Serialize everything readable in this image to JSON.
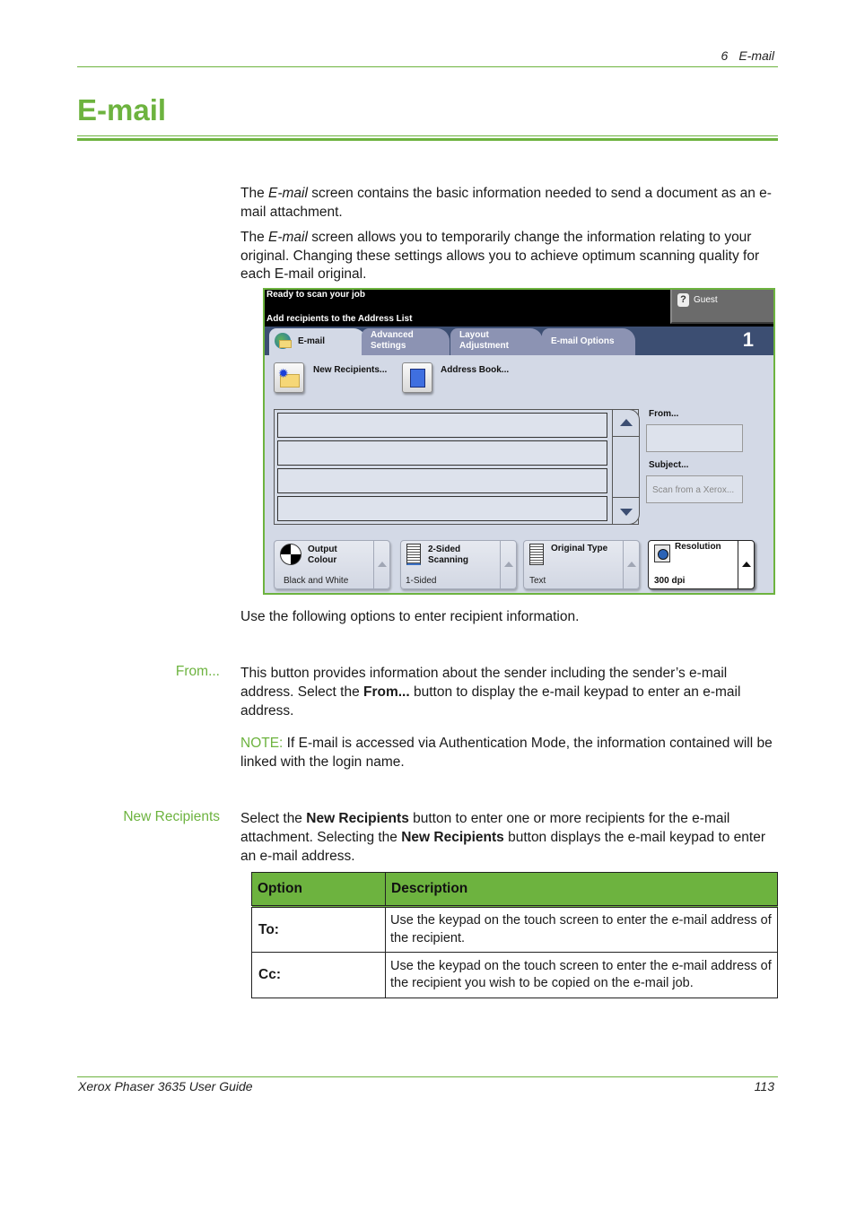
{
  "header": {
    "chapter_number": "6",
    "chapter_title": "E-mail"
  },
  "page_title": "E-mail",
  "intro": {
    "p1_pre": "The ",
    "p1_em": "E-mail",
    "p1_post": " screen contains the basic information needed to send a document as an e-mail attachment.",
    "p2_pre": "The ",
    "p2_em": "E-mail",
    "p2_post": " screen allows you to temporarily change the information relating to your original. Changing these settings allows you to achieve optimum scanning quality for each E-mail original."
  },
  "device_screen": {
    "status_line_1": "Ready to scan your job",
    "status_line_2": "Add recipients to the Address List",
    "user_button": "Guest",
    "page_count": "1",
    "tabs": [
      {
        "label": "E-mail",
        "active": true
      },
      {
        "label": "Advanced Settings",
        "line1": "Advanced",
        "line2": "Settings",
        "active": false
      },
      {
        "label": "Layout Adjustment",
        "line1": "Layout",
        "line2": "Adjustment",
        "active": false
      },
      {
        "label": "E-mail Options",
        "active": false
      }
    ],
    "new_recipients_label": "New Recipients...",
    "address_book_label": "Address Book...",
    "recipient_rows": [
      "",
      "",
      "",
      ""
    ],
    "from_label": "From...",
    "from_value": "",
    "subject_label": "Subject...",
    "subject_value": "Scan from a Xerox...",
    "options": [
      {
        "title_line1": "Output",
        "title_line2": "Colour",
        "value": "Black and White",
        "selected": false
      },
      {
        "title_line1": "2-Sided",
        "title_line2": "Scanning",
        "value": "1-Sided",
        "selected": false
      },
      {
        "title_line1": "Original Type",
        "title_line2": "",
        "value": "Text",
        "selected": false
      },
      {
        "title_line1": "Resolution",
        "title_line2": "",
        "value": "300 dpi",
        "selected": true
      }
    ]
  },
  "after_screen_text": "Use the following options to enter recipient information.",
  "sections": {
    "from": {
      "label": "From...",
      "body_pre": "This button provides information about the sender including the sender’s e-mail address. Select the ",
      "body_bold": "From...",
      "body_post": " button to display the e-mail keypad to enter an e-mail address.",
      "note_label": "NOTE:",
      "note_text": " If E-mail is accessed via Authentication Mode, the information contained will be linked with the login name."
    },
    "new_recipients": {
      "label": "New Recipients",
      "body_1": "Select the ",
      "body_bold_1": "New Recipients",
      "body_2": " button to enter one or more recipients for the e-mail attachment. Selecting the ",
      "body_bold_2": "New Recipients",
      "body_3": " button displays the e-mail keypad to enter an e-mail address."
    }
  },
  "table": {
    "headers": [
      "Option",
      "Description"
    ],
    "rows": [
      {
        "option": "To:",
        "description": "Use the keypad on the touch screen to enter the e-mail address of the recipient."
      },
      {
        "option": "Cc:",
        "description": "Use the keypad on the touch screen to enter the e-mail address of the recipient you wish to be copied on the e-mail job."
      }
    ]
  },
  "footer": {
    "guide_title": "Xerox Phaser 3635 User Guide",
    "page_number": "113"
  },
  "colors": {
    "accent_green": "#6db33f",
    "device_tabbar": "#3c4e72",
    "device_panel": "#d3d9e6"
  }
}
